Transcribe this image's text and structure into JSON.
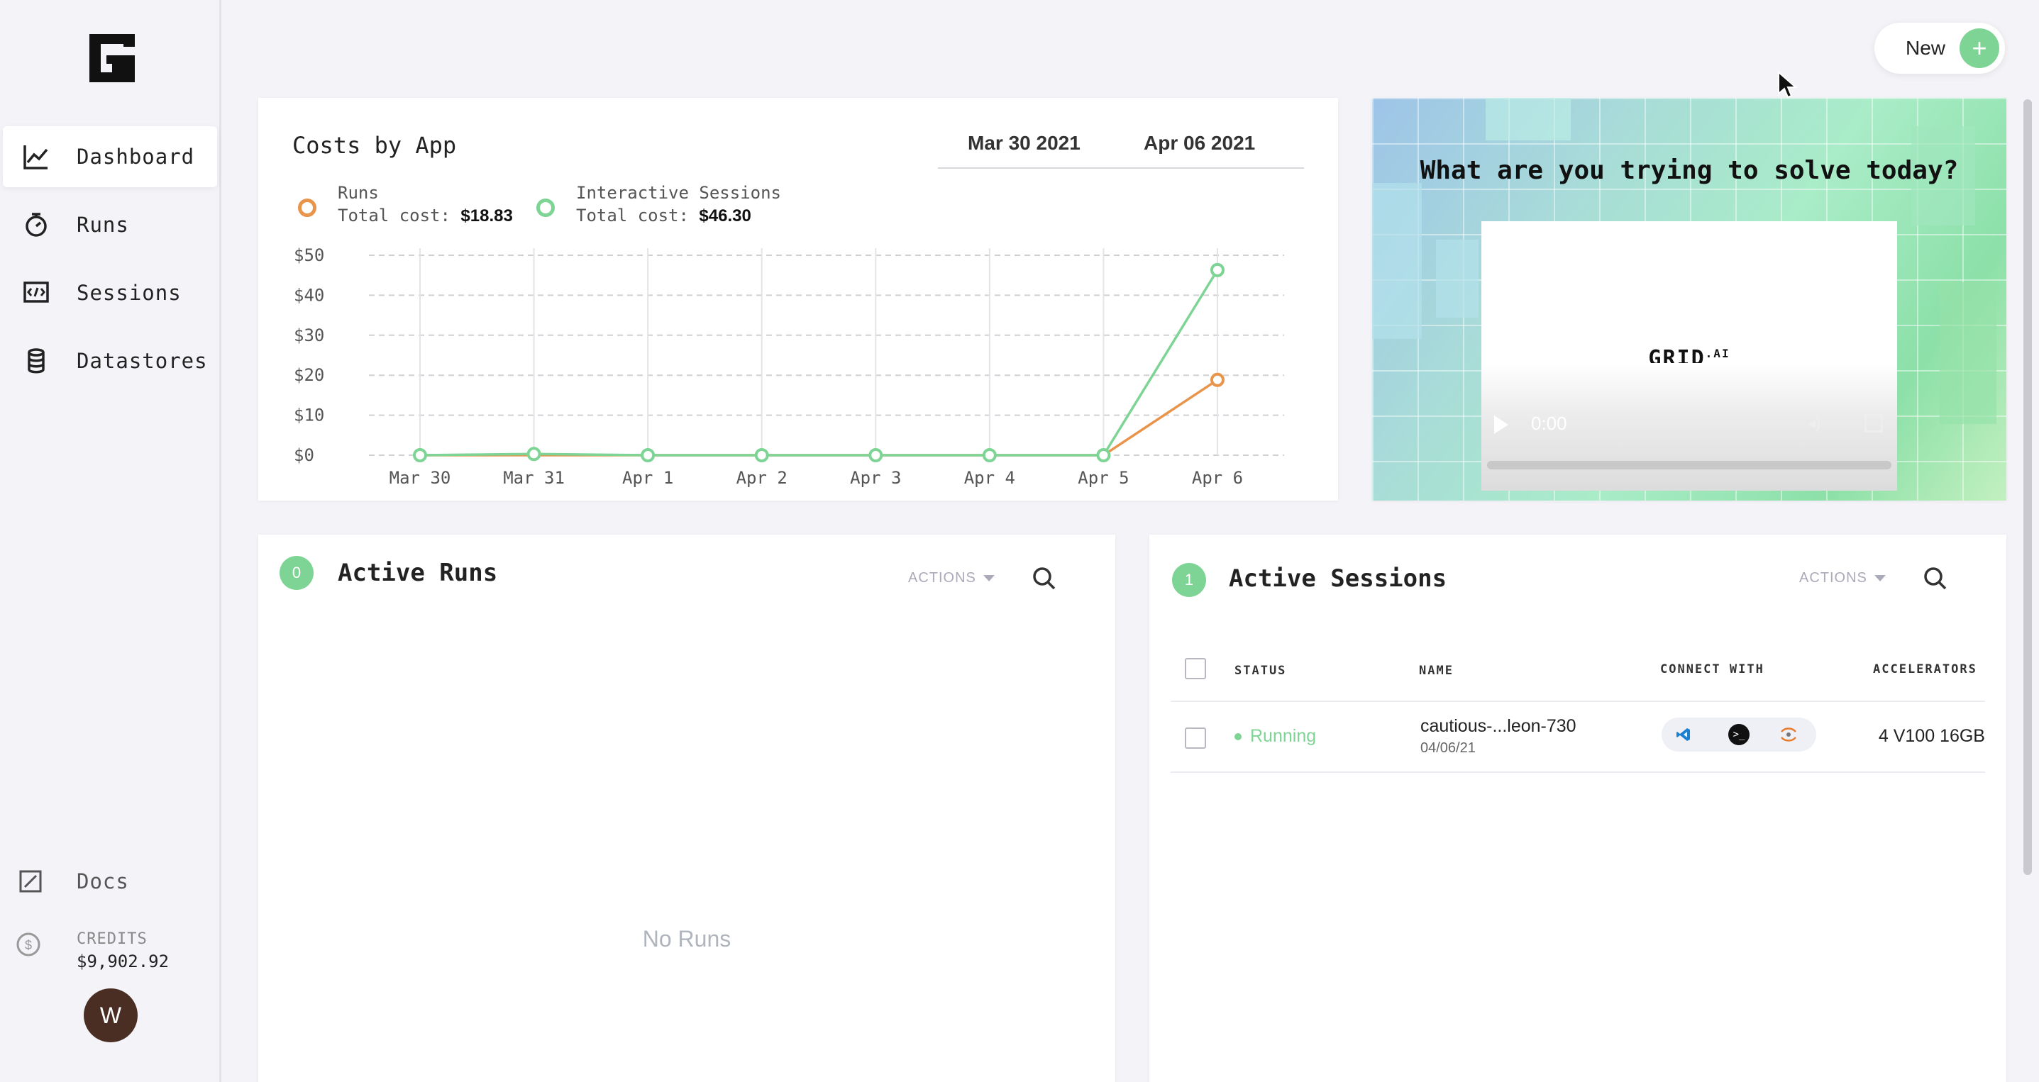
{
  "sidebar": {
    "items": [
      {
        "label": "Dashboard",
        "icon": "chart-line-icon",
        "active": true
      },
      {
        "label": "Runs",
        "icon": "stopwatch-icon"
      },
      {
        "label": "Sessions",
        "icon": "code-window-icon"
      },
      {
        "label": "Datastores",
        "icon": "database-icon"
      }
    ],
    "docs_label": "Docs",
    "credits_title": "CREDITS",
    "credits_value": "$9,902.92",
    "avatar_initial": "W"
  },
  "header": {
    "new_label": "New",
    "new_icon": "+"
  },
  "costs": {
    "title": "Costs by App",
    "date_from": "Mar 30 2021",
    "date_to": "Apr 06 2021",
    "legend": [
      {
        "name": "Runs",
        "total_label": "Total cost:",
        "total": "$18.83",
        "color": "#e8944a"
      },
      {
        "name": "Interactive Sessions",
        "total_label": "Total cost:",
        "total": "$46.30",
        "color": "#7ed495"
      }
    ]
  },
  "chart_data": {
    "type": "line",
    "x": [
      "Mar 30",
      "Mar 31",
      "Apr 1",
      "Apr 2",
      "Apr 3",
      "Apr 4",
      "Apr 5",
      "Apr 6"
    ],
    "series": [
      {
        "name": "Runs",
        "values": [
          0,
          0,
          0,
          0,
          0,
          0,
          0,
          18.83
        ],
        "color": "#e8944a"
      },
      {
        "name": "Interactive Sessions",
        "values": [
          0,
          0.3,
          0,
          0,
          0,
          0,
          0,
          46.3
        ],
        "color": "#7ed495"
      }
    ],
    "yticks": [
      "$0",
      "$10",
      "$20",
      "$30",
      "$40",
      "$50"
    ],
    "ylim": [
      0,
      50
    ],
    "grid": true
  },
  "video": {
    "question": "What are you trying to solve today?",
    "logo": "GRID",
    "logo_sup": ".AI",
    "time": "0:00"
  },
  "runs": {
    "count": "0",
    "title": "Active Runs",
    "actions_label": "ACTIONS",
    "empty_text": "No Runs"
  },
  "sessions": {
    "count": "1",
    "title": "Active Sessions",
    "actions_label": "ACTIONS",
    "columns": [
      "STATUS",
      "NAME",
      "CONNECT WITH",
      "ACCELERATORS"
    ],
    "rows": [
      {
        "status": "Running",
        "name": "cautious-...leon-730",
        "date": "04/06/21",
        "accelerators": "4 V100 16GB",
        "connect": [
          "vscode-icon",
          "terminal-icon",
          "jupyter-icon"
        ]
      }
    ]
  }
}
